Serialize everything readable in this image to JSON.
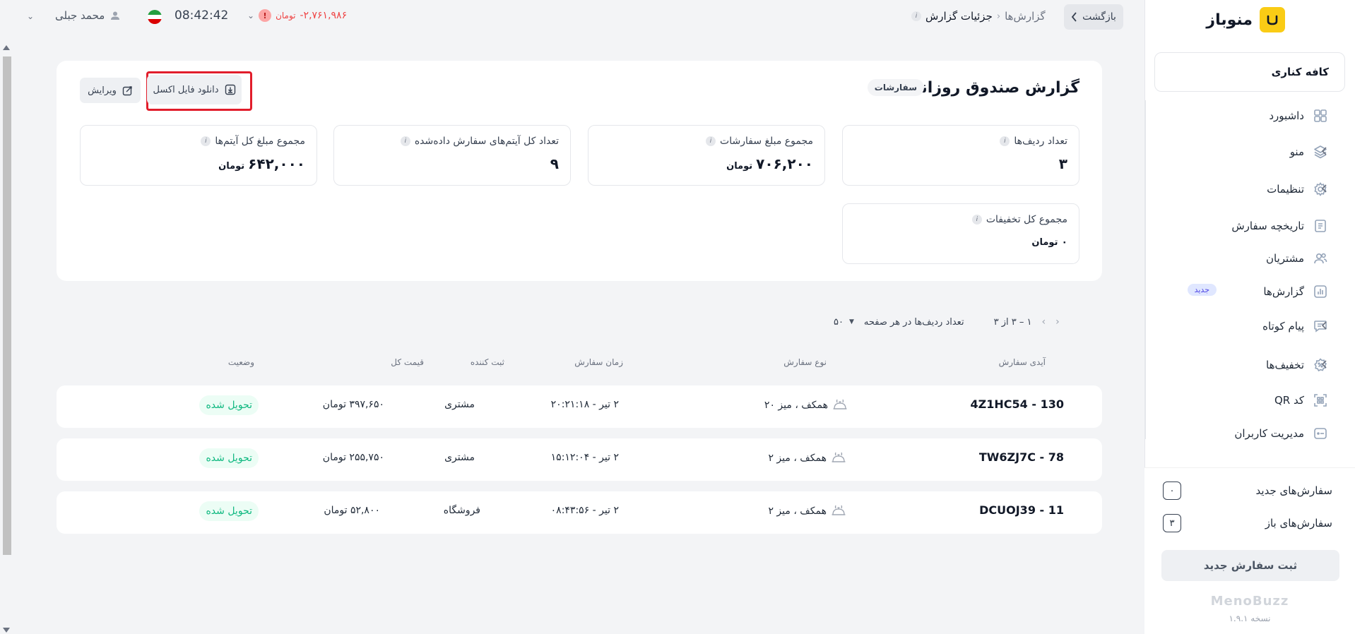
{
  "app": {
    "brand_name": "منوباز",
    "cafe_name": "کافه کناری"
  },
  "sidebar": {
    "items": [
      {
        "label": "داشبورد",
        "icon": "grid-icon",
        "has_chevron": false
      },
      {
        "label": "منو",
        "icon": "layers-icon",
        "has_chevron": true
      },
      {
        "label": "تنظیمات",
        "icon": "gear-icon",
        "has_chevron": true
      },
      {
        "label": "تاریخچه سفارش",
        "icon": "document-icon",
        "has_chevron": false
      },
      {
        "label": "مشتریان",
        "icon": "users-icon",
        "has_chevron": false
      },
      {
        "label": "گزارش‌ها",
        "icon": "chart-icon",
        "has_chevron": false,
        "badge": "جدید"
      },
      {
        "label": "پیام کوتاه",
        "icon": "message-icon",
        "has_chevron": true
      },
      {
        "label": "تخفیف‌ها",
        "icon": "discount-icon",
        "has_chevron": true
      },
      {
        "label": "کد QR",
        "icon": "qr-icon",
        "has_chevron": false
      },
      {
        "label": "مدیریت کاربران",
        "icon": "user-manage-icon",
        "has_chevron": false
      }
    ],
    "new_orders_label": "سفارش‌های جدید",
    "new_orders_count": "۰",
    "open_orders_label": "سفارش‌های باز",
    "open_orders_count": "۳",
    "new_order_button": "ثبت سفارش جدید",
    "footer_logo": "MenoBuzz",
    "version": "نسخه ۱.۹.۱"
  },
  "topbar": {
    "back_label": "بازگشت",
    "breadcrumb_parent": "گزارش‌ها",
    "breadcrumb_current": "جزئیات گزارش",
    "balance_value": "-۲,۷۶۱,۹۸۶",
    "balance_unit": "تومان",
    "balance_alert": "!",
    "clock": "08:42:42",
    "user_name": "محمد جبلی"
  },
  "report": {
    "title": "گزارش صندوق روزانه نقد",
    "chip": "سفارشات",
    "download_excel_label": "دانلود فایل اکسل",
    "edit_label": "ویرایش",
    "stats": {
      "row_count": {
        "label": "تعداد ردیف‌ها",
        "value": "۳"
      },
      "orders_sum": {
        "label": "مجموع مبلغ سفارشات",
        "value": "۷۰۶,۲۰۰",
        "unit": "تومان"
      },
      "items_count": {
        "label": "تعداد کل آیتم‌های سفارش داده‌شده",
        "value": "۹"
      },
      "items_sum": {
        "label": "مجموع مبلغ کل آیتم‌ها",
        "value": "۶۴۲,۰۰۰",
        "unit": "تومان"
      },
      "discount_sum": {
        "label": "مجموع کل تخفیفات",
        "value": "۰",
        "unit": "تومان"
      }
    }
  },
  "pagination": {
    "range": "۱ – ۳ از ۳",
    "per_page_label": "تعداد ردیف‌ها در هر صفحه",
    "per_page_value": "۵۰"
  },
  "table": {
    "headers": {
      "order_id": "آیدی سفارش",
      "order_type": "نوع سفارش",
      "order_time": "زمان سفارش",
      "registrar": "ثبت کننده",
      "total_price": "قیمت کل",
      "status": "وضعیت"
    },
    "rows": [
      {
        "order_id": "4Z1HC54 - 130",
        "order_type": "همکف ، میز ۲۰",
        "order_time": "۲ تیر - ۲۰:۲۱:۱۸",
        "registrar": "مشتری",
        "total_price": "۳۹۷,۶۵۰ تومان",
        "status": "تحویل شده"
      },
      {
        "order_id": "TW6ZJ7C - 78",
        "order_type": "همکف ، میز ۲",
        "order_time": "۲ تیر - ۱۵:۱۲:۰۴",
        "registrar": "مشتری",
        "total_price": "۲۵۵,۷۵۰ تومان",
        "status": "تحویل شده"
      },
      {
        "order_id": "DCUOJ39 - 11",
        "order_type": "همکف ، میز ۲",
        "order_time": "۲ تیر - ۰۸:۴۳:۵۶",
        "registrar": "فروشگاه",
        "total_price": "۵۲,۸۰۰ تومان",
        "status": "تحویل شده"
      }
    ]
  },
  "colors": {
    "brand": "#facc15",
    "danger": "#ef4444",
    "success": "#10b981",
    "highlight": "#e11d2b"
  }
}
